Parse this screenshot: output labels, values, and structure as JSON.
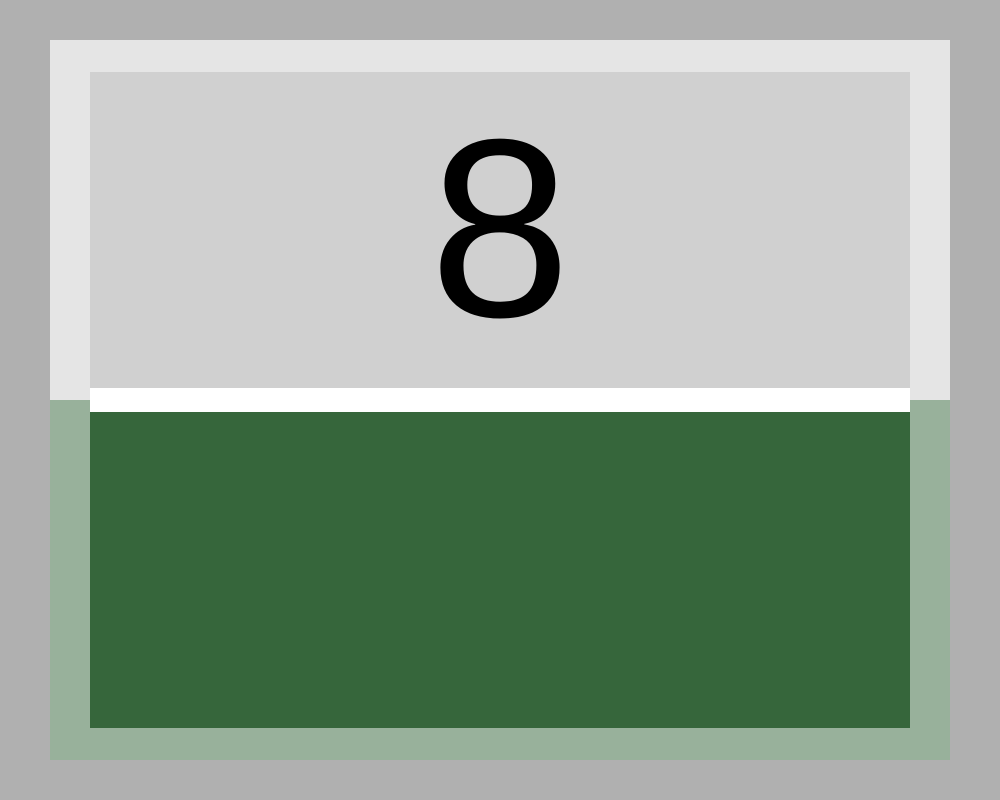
{
  "card": {
    "number": "8",
    "colors": {
      "background": "#b0b0b0",
      "frame_top": "#e5e5e5",
      "frame_bottom": "#98b19b",
      "number_panel": "#d0d0d0",
      "divider": "#ffffff",
      "green_panel": "#36663b"
    }
  }
}
